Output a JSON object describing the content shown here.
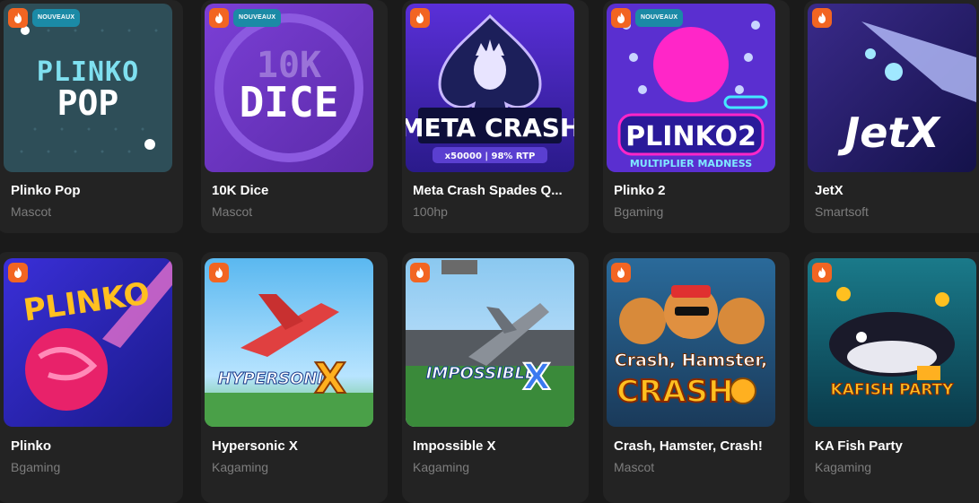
{
  "games": [
    {
      "title": "Plinko Pop",
      "provider": "Mascot",
      "badge": "NOUVEAUX",
      "art_text_1": "PLINKO",
      "art_text_2": "POP"
    },
    {
      "title": "10K Dice",
      "provider": "Mascot",
      "badge": "NOUVEAUX",
      "art_text_1": "10K",
      "art_text_2": "DICE"
    },
    {
      "title": "Meta Crash Spades Q...",
      "provider": "100hp",
      "badge": "",
      "art_text_1": "META CRASH",
      "art_text_2": "x50000  |  98% RTP"
    },
    {
      "title": "Plinko 2",
      "provider": "Bgaming",
      "badge": "NOUVEAUX",
      "art_text_1": "PLINKO2",
      "art_text_2": "MULTIPLIER MADNESS"
    },
    {
      "title": "JetX",
      "provider": "Smartsoft",
      "badge": "",
      "art_text_1": "JetX",
      "art_text_2": ""
    },
    {
      "title": "Plinko",
      "provider": "Bgaming",
      "badge": "",
      "art_text_1": "PLINKO",
      "art_text_2": ""
    },
    {
      "title": "Hypersonic X",
      "provider": "Kagaming",
      "badge": "",
      "art_text_1": "HYPERSONIC",
      "art_text_2": "X"
    },
    {
      "title": "Impossible X",
      "provider": "Kagaming",
      "badge": "",
      "art_text_1": "IMPOSSIBLE",
      "art_text_2": "X"
    },
    {
      "title": "Crash, Hamster, Crash!",
      "provider": "Mascot",
      "badge": "",
      "art_text_1": "Crash, Hamster,",
      "art_text_2": "CRASH!"
    },
    {
      "title": "KA Fish Party",
      "provider": "Kagaming",
      "badge": "",
      "art_text_1": "KAFISH PARTY",
      "art_text_2": ""
    }
  ],
  "colors": {
    "page_bg": "#1a1a1a",
    "card_bg": "#232323",
    "hot_badge": "#f26522",
    "new_badge": "#1b8aa6",
    "provider_text": "#7d7d7d"
  },
  "icons": {
    "hot": "fire-icon"
  }
}
